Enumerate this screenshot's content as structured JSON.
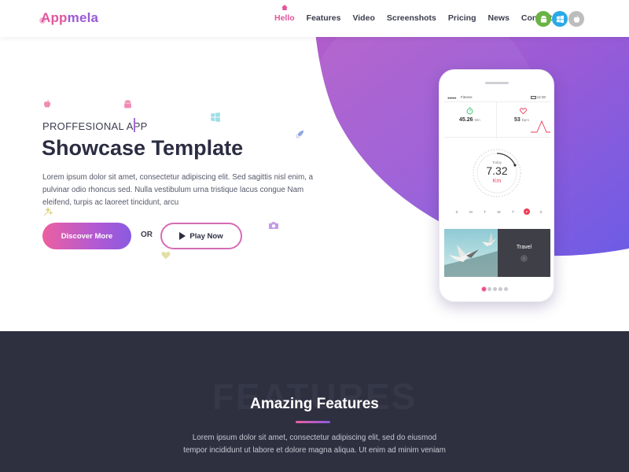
{
  "brand": {
    "logo_first": "App",
    "logo_rest": "mela"
  },
  "nav": {
    "items": [
      "Hello",
      "Features",
      "Video",
      "Screenshots",
      "Pricing",
      "News",
      "Contact"
    ],
    "active_index": 0
  },
  "stores": [
    {
      "icon": "android-icon",
      "color": "#6ab344"
    },
    {
      "icon": "windows-icon",
      "color": "#29a9e6"
    },
    {
      "icon": "apple-icon",
      "color": "#bdbdbd"
    }
  ],
  "hero": {
    "subtitle": "PROFFESIONAL APP",
    "title": "Showcase Template",
    "text": "Lorem ipsum dolor sit amet, consectetur adipiscing elit. Sed sagittis nisl enim, a pulvinar odio rhoncus sed. Nulla vestibulum urna tristique lacus congue Nam eleifend, turpis ac laoreet tincidunt, arcu",
    "discover_label": "Discover More",
    "or_label": "OR",
    "play_label": "Play Now"
  },
  "phone": {
    "status_app": "Fitness",
    "status_time": "12:30",
    "stat_time_value": "45.26",
    "stat_time_unit": "Min",
    "stat_heart_value": "53",
    "stat_heart_unit": "Bpm",
    "dial_label": "Today",
    "dial_value": "7.32",
    "dial_unit": "Km",
    "days": [
      "S",
      "M",
      "T",
      "W",
      "T",
      "F",
      "S"
    ],
    "selected_day_index": 5,
    "travel_label": "Travel",
    "slide_count": 5,
    "active_slide": 0
  },
  "features": {
    "ghost_text": "FEATURES",
    "title": "Amazing Features",
    "text_line1": "Lorem ipsum dolor sit amet, consectetur adipiscing elit, sed do eiusmod",
    "text_line2": "tempor incididunt ut labore et dolore magna aliqua. Ut enim ad minim veniam"
  },
  "colors": {
    "accent_pink": "#e2569c",
    "accent_purple": "#8a5ae0",
    "dark_section": "#2e3040"
  }
}
